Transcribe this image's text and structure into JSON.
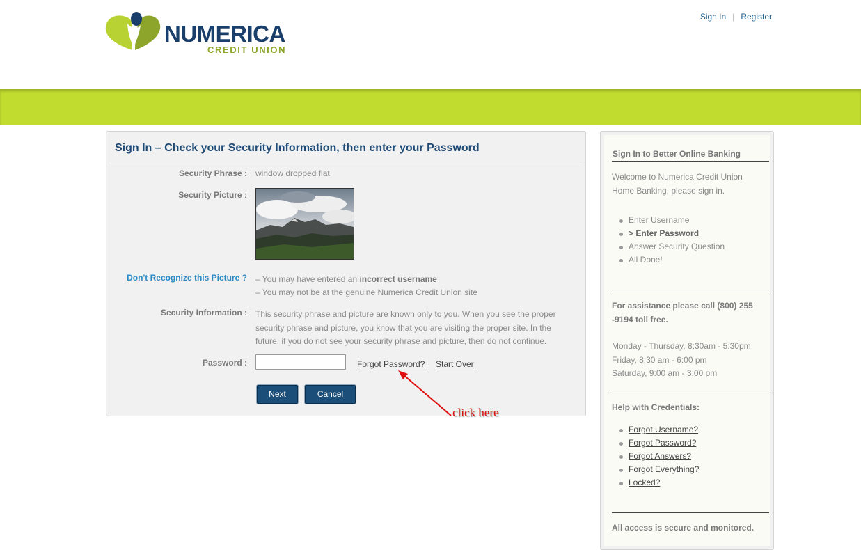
{
  "brand": {
    "name": "NUMERICA",
    "sub": "CREDIT UNION",
    "green": "#c1db2f",
    "navy": "#1e4a75"
  },
  "top_links": {
    "sign_in": "Sign In",
    "separator": "|",
    "register": "Register"
  },
  "main": {
    "title": "Sign In – Check your Security Information, then enter your Password",
    "security_phrase_label": "Security Phrase :",
    "security_phrase_value": "window dropped flat",
    "security_picture_label": "Security Picture :",
    "dont_recognize": "Don't Recognize this Picture ?",
    "recognize_line1_prefix": "– You may have entered an ",
    "recognize_line1_bold": "incorrect username",
    "recognize_line2": "– You may not be at the genuine Numerica Credit Union site",
    "security_info_label": "Security Information :",
    "security_info_text": "This security phrase and picture are known only to you. When you see the proper security phrase and picture, you know that you are visiting the proper site. In the future, if you do not see your security phrase and picture, then do not continue.",
    "password_label": "Password :",
    "password_value": "",
    "forgot_password": "Forgot Password?",
    "start_over": "Start Over",
    "next": "Next",
    "cancel": "Cancel"
  },
  "annotation": {
    "text": "click here",
    "color": "#e01010"
  },
  "sidebar": {
    "title": "Sign In to Better Online Banking",
    "welcome": "Welcome to Numerica Credit Union Home Banking, please sign in.",
    "steps": [
      "Enter Username",
      "> Enter Password",
      "Answer Security Question",
      "All Done!"
    ],
    "assistance": "For assistance please call (800) 255 -9194 toll free.",
    "hours": [
      "Monday - Thursday, 8:30am - 5:30pm",
      "Friday, 8:30 am - 6:00 pm",
      "Saturday, 9:00 am - 3:00 pm"
    ],
    "help_title": "Help with Credentials:",
    "help_links": [
      "Forgot Username?",
      "Forgot Password?",
      "Forgot Answers?",
      "Forgot Everything?",
      "Locked?"
    ],
    "secure": "All access is secure and monitored."
  }
}
